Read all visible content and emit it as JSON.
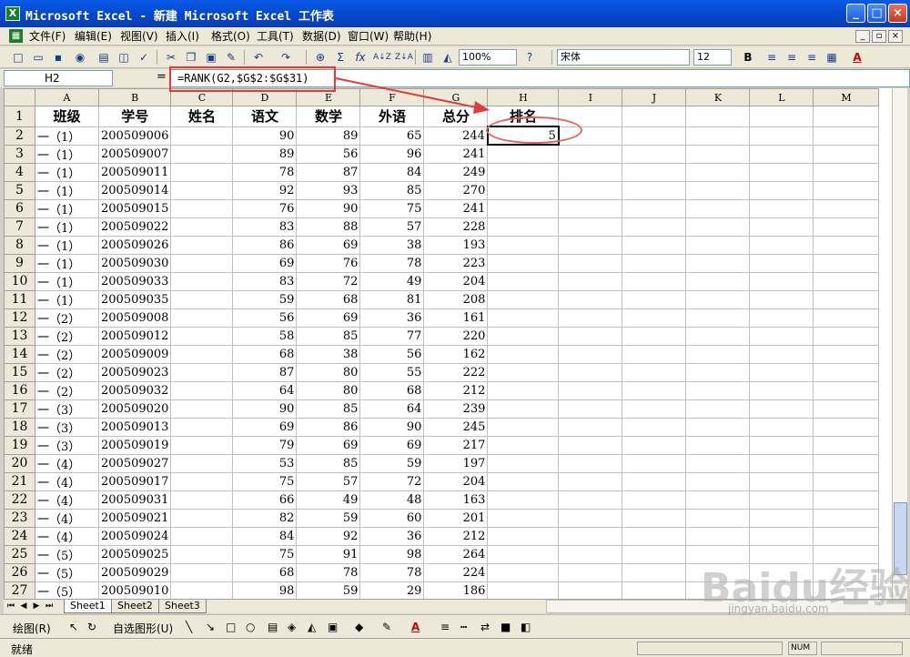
{
  "window": {
    "title": "Microsoft Excel - 新建 Microsoft Excel 工作表",
    "app_icon": "X",
    "controls": [
      "_",
      "□",
      "×"
    ]
  },
  "menubar": {
    "items": [
      "文件(F)",
      "编辑(E)",
      "视图(V)",
      "插入(I)",
      "格式(O)",
      "工具(T)",
      "数据(D)",
      "窗口(W)",
      "帮助(H)"
    ],
    "doc_controls": [
      "_",
      "▫",
      "×"
    ]
  },
  "toolbar": {
    "zoom": "100%",
    "font_name": "宋体",
    "font_size": "12",
    "bold_label": "B",
    "fx_label": "fx",
    "sort_asc": "A↓Z",
    "sort_desc": "Z↓A",
    "font_color_label": "A"
  },
  "formula_bar": {
    "cell_ref": "H2",
    "equals": "=",
    "formula": "=RANK(G2,$G$2:$G$31)"
  },
  "grid": {
    "columns": [
      "A",
      "B",
      "C",
      "D",
      "E",
      "F",
      "G",
      "H",
      "I",
      "J",
      "K",
      "L",
      "M"
    ],
    "headers": [
      "班级",
      "学号",
      "姓名",
      "语文",
      "数学",
      "外语",
      "总分",
      "排名"
    ],
    "rows": [
      [
        "一（1）",
        "200509006",
        "",
        "90",
        "89",
        "65",
        "244",
        "5"
      ],
      [
        "一（1）",
        "200509007",
        "",
        "89",
        "56",
        "96",
        "241",
        ""
      ],
      [
        "一（1）",
        "200509011",
        "",
        "78",
        "87",
        "84",
        "249",
        ""
      ],
      [
        "一（1）",
        "200509014",
        "",
        "92",
        "93",
        "85",
        "270",
        ""
      ],
      [
        "一（1）",
        "200509015",
        "",
        "76",
        "90",
        "75",
        "241",
        ""
      ],
      [
        "一（1）",
        "200509022",
        "",
        "83",
        "88",
        "57",
        "228",
        ""
      ],
      [
        "一（1）",
        "200509026",
        "",
        "86",
        "69",
        "38",
        "193",
        ""
      ],
      [
        "一（1）",
        "200509030",
        "",
        "69",
        "76",
        "78",
        "223",
        ""
      ],
      [
        "一（1）",
        "200509033",
        "",
        "83",
        "72",
        "49",
        "204",
        ""
      ],
      [
        "一（1）",
        "200509035",
        "",
        "59",
        "68",
        "81",
        "208",
        ""
      ],
      [
        "一（2）",
        "200509008",
        "",
        "56",
        "69",
        "36",
        "161",
        ""
      ],
      [
        "一（2）",
        "200509012",
        "",
        "58",
        "85",
        "77",
        "220",
        ""
      ],
      [
        "一（2）",
        "200509009",
        "",
        "68",
        "38",
        "56",
        "162",
        ""
      ],
      [
        "一（2）",
        "200509023",
        "",
        "87",
        "80",
        "55",
        "222",
        ""
      ],
      [
        "一（2）",
        "200509032",
        "",
        "64",
        "80",
        "68",
        "212",
        ""
      ],
      [
        "一（3）",
        "200509020",
        "",
        "90",
        "85",
        "64",
        "239",
        ""
      ],
      [
        "一（3）",
        "200509013",
        "",
        "69",
        "86",
        "90",
        "245",
        ""
      ],
      [
        "一（3）",
        "200509019",
        "",
        "79",
        "69",
        "69",
        "217",
        ""
      ],
      [
        "一（4）",
        "200509027",
        "",
        "53",
        "85",
        "59",
        "197",
        ""
      ],
      [
        "一（4）",
        "200509017",
        "",
        "75",
        "57",
        "72",
        "204",
        ""
      ],
      [
        "一（4）",
        "200509031",
        "",
        "66",
        "49",
        "48",
        "163",
        ""
      ],
      [
        "一（4）",
        "200509021",
        "",
        "82",
        "59",
        "60",
        "201",
        ""
      ],
      [
        "一（4）",
        "200509024",
        "",
        "84",
        "92",
        "36",
        "212",
        ""
      ],
      [
        "一（5）",
        "200509025",
        "",
        "75",
        "91",
        "98",
        "264",
        ""
      ],
      [
        "一（5）",
        "200509029",
        "",
        "68",
        "78",
        "78",
        "224",
        ""
      ],
      [
        "一（5）",
        "200509010",
        "",
        "98",
        "59",
        "29",
        "186",
        ""
      ]
    ]
  },
  "sheets": {
    "tabs": [
      "Sheet1",
      "Sheet2",
      "Sheet3"
    ],
    "active": "Sheet1"
  },
  "drawbar": {
    "draw_label": "绘图(R)",
    "autoshape_label": "自选图形(U)"
  },
  "status": {
    "text": "就绪",
    "num_indicator": "NUM"
  },
  "watermark": {
    "main": "Baidu经验",
    "sub": "jingyan.baidu.com"
  },
  "colors": {
    "annotation": "#e23b3b",
    "titlebar": "#0646c8"
  }
}
